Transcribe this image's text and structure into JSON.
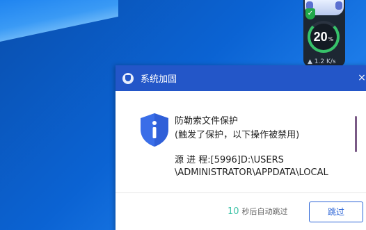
{
  "widget": {
    "percent": "20",
    "percent_unit": "%",
    "net_speed": "▲ 1.2 K/s"
  },
  "dialog": {
    "title": "系统加固",
    "close_label": "×",
    "heading": "防勒索文件保护",
    "subheading": "(触发了保护，以下操作被禁用)",
    "process_lines": [
      "源 进 程:[5996]D:\\USERS",
      "\\ADMINISTRATOR\\APPDATA\\LOCAL"
    ],
    "countdown_seconds": "10",
    "countdown_text": "秒后自动跳过",
    "skip_label": "跳过"
  },
  "colors": {
    "titlebar": "#2356c8",
    "accent": "#2a63d6",
    "countdown": "#3fc4a8",
    "shield": "#3a6ee8"
  }
}
